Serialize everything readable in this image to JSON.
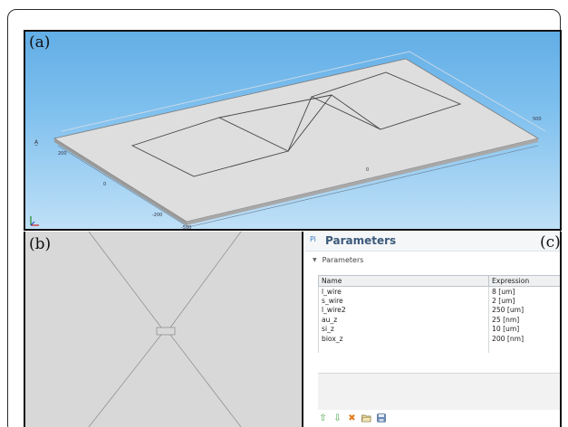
{
  "labels": {
    "panel_a": "(a)",
    "panel_b": "(b)",
    "panel_c": "(c)"
  },
  "model_view": {
    "axis_labels": {
      "y_top": "200",
      "y_mid": "0",
      "y_bottom": "-200",
      "x_left": "-500",
      "x_mid": "0",
      "x_right": "500"
    }
  },
  "parameters": {
    "header_icon": "Pi",
    "title": "Parameters",
    "section_label": "Parameters",
    "columns": [
      "Name",
      "Expression"
    ],
    "rows": [
      {
        "name": "l_wire",
        "expr": "8 [um]"
      },
      {
        "name": "s_wire",
        "expr": "2 [um]"
      },
      {
        "name": "l_wire2",
        "expr": "250 [um]"
      },
      {
        "name": "au_z",
        "expr": "25 [nm]"
      },
      {
        "name": "si_z",
        "expr": "10 [um]"
      },
      {
        "name": "biox_z",
        "expr": "200 [nm]"
      }
    ],
    "toolbar_icons": [
      "move-up-icon",
      "move-down-icon",
      "delete-icon",
      "open-folder-icon",
      "save-icon"
    ]
  },
  "colors": {
    "sky_top": "#62aee6",
    "sky_bottom": "#bfe0f7",
    "plate": "#dedede",
    "plate_side": "#9a9a9a",
    "toolbar_green": "#43a047",
    "toolbar_red": "#e67e22",
    "header_blue": "#3c5a7a"
  }
}
